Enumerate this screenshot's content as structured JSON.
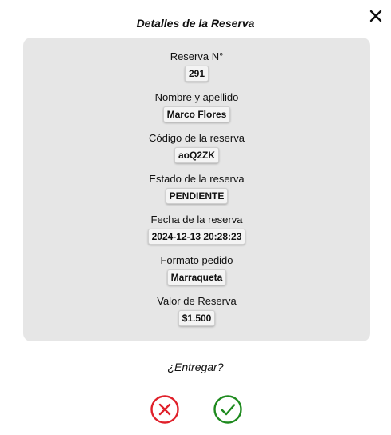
{
  "modal": {
    "title": "Detalles de la Reserva"
  },
  "fields": [
    {
      "label": "Reserva N°",
      "value": "291"
    },
    {
      "label": "Nombre y apellido",
      "value": "Marco Flores"
    },
    {
      "label": "Código de la reserva",
      "value": "aoQ2ZK"
    },
    {
      "label": "Estado de la reserva",
      "value": "PENDIENTE"
    },
    {
      "label": "Fecha de la reserva",
      "value": "2024-12-13 20:28:23"
    },
    {
      "label": "Formato pedido",
      "value": "Marraqueta"
    },
    {
      "label": "Valor de Reserva",
      "value": "$1.500"
    }
  ],
  "confirm": {
    "question": "¿Entregar?",
    "reject_icon": "x-circle-icon",
    "accept_icon": "check-circle-icon"
  },
  "colors": {
    "reject": "#e0202a",
    "accept": "#1e8a1e",
    "card_bg": "#e6e6e6"
  }
}
